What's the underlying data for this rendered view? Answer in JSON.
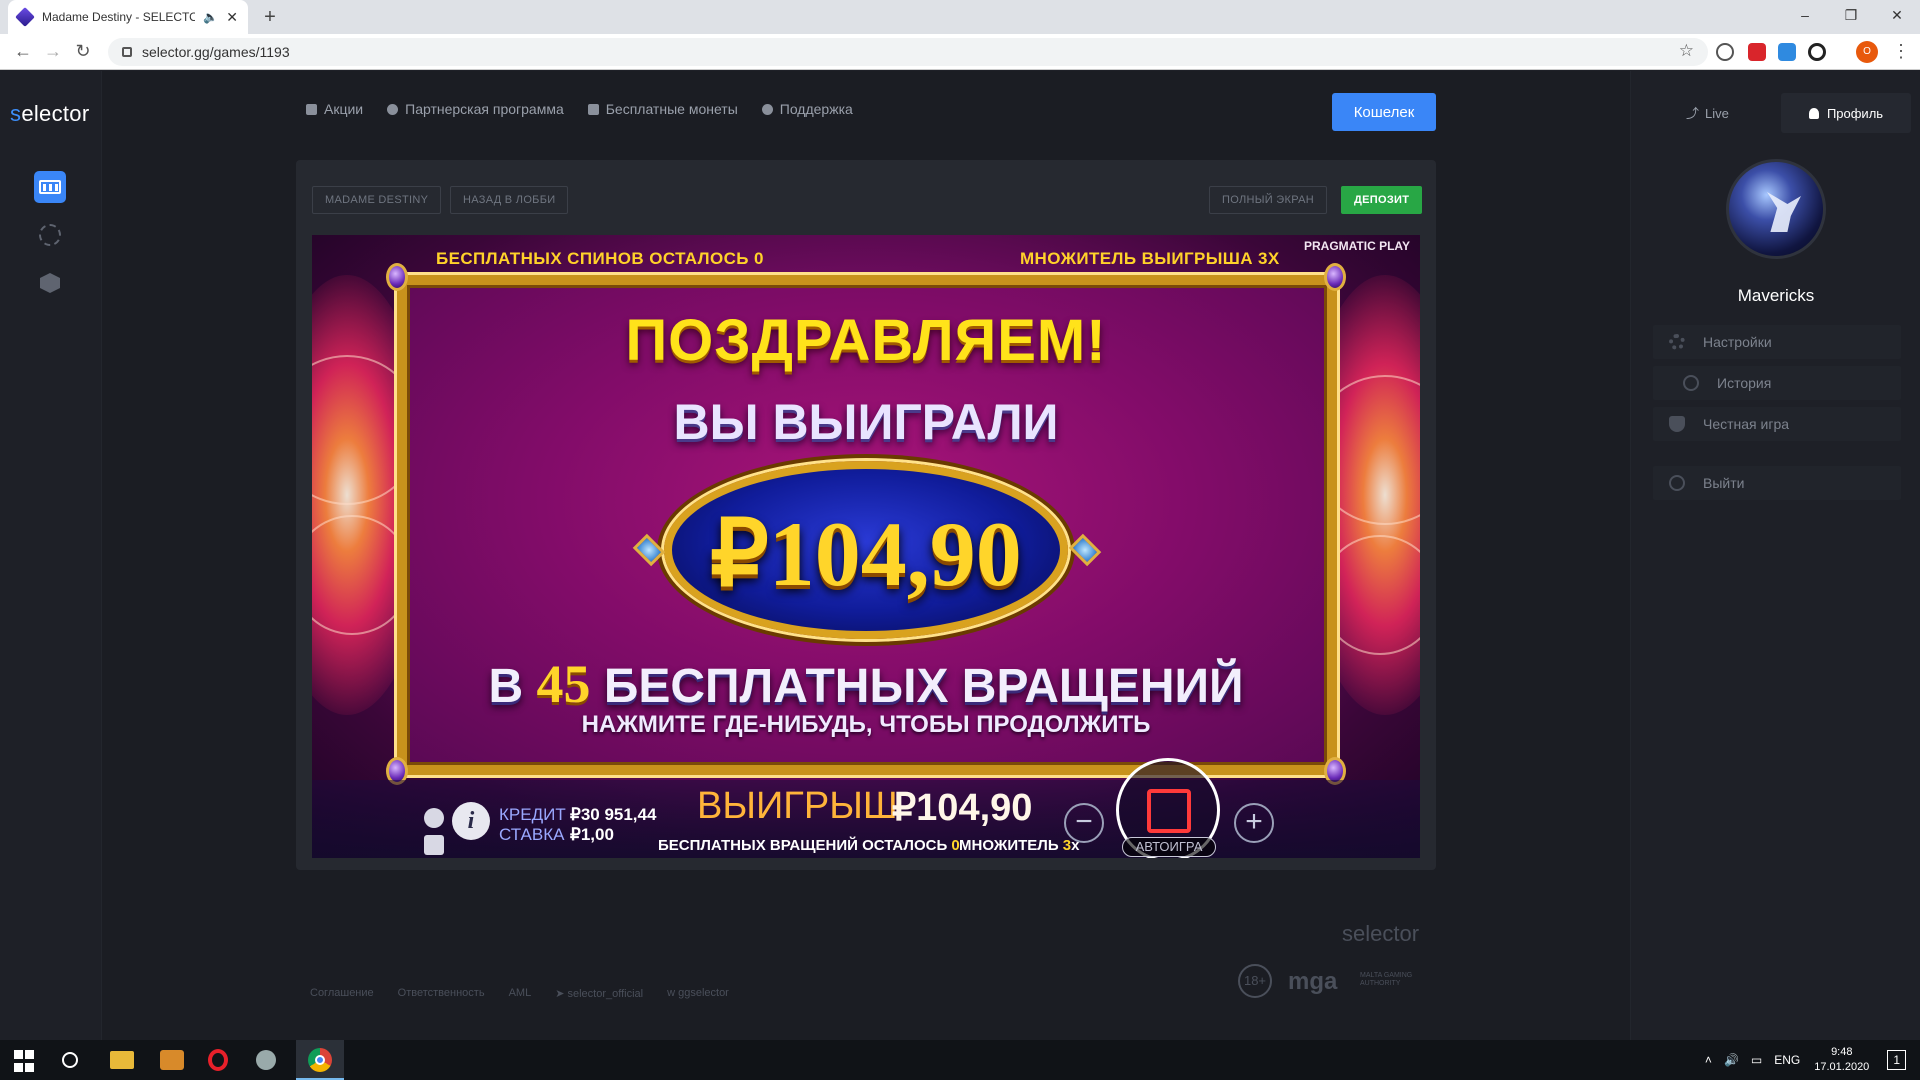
{
  "browser": {
    "tab_title": "Madame Destiny - SELECTOR",
    "tab_speaker_icon": "speaker-icon",
    "new_tab": "+",
    "url": "selector.gg/games/1193",
    "window_controls": [
      "–",
      "❐",
      "✕"
    ]
  },
  "app": {
    "logo_prefix": "s",
    "logo_rest": "elector",
    "nav": [
      {
        "label": "Акции",
        "icon": "calendar-icon"
      },
      {
        "label": "Партнерская программа",
        "icon": "handshake-icon"
      },
      {
        "label": "Бесплатные монеты",
        "icon": "gift-icon"
      },
      {
        "label": "Поддержка",
        "icon": "support-icon"
      }
    ],
    "wallet": "Кошелек",
    "live": "Live",
    "profile": "Профиль"
  },
  "user": {
    "name": "Mavericks",
    "menu": [
      "Настройки",
      "История",
      "Честная игра",
      "Выйти"
    ]
  },
  "game_header": {
    "game_name": "MADAME DESTINY",
    "back": "НАЗАД В ЛОББИ",
    "fullscreen": "ПОЛНЫЙ ЭКРАН",
    "deposit": "ДЕПОЗИТ"
  },
  "game": {
    "free_spins_left": "БЕСПЛАТНЫХ СПИНОВ ОСТАЛОСЬ  0",
    "multiplier": "МНОЖИТЕЛЬ ВЫИГРЫША 3X",
    "provider": "PRAGMATIC PLAY",
    "congrats": "ПОЗДРАВЛЯЕМ!",
    "you_won": "ВЫ ВЫИГРАЛИ",
    "amount": "₽104,90",
    "spins_prefix": "В",
    "spins_num": "45",
    "spins_suffix": "БЕСПЛАТНЫХ ВРАЩЕНИЙ",
    "press_anywhere": "НАЖМИТЕ ГДЕ-НИБУДЬ, ЧТОБЫ ПРОДОЛЖИТЬ",
    "credit_label": "КРЕДИТ",
    "credit_value": "₽30 951,44",
    "bet_label": "СТАВКА",
    "bet_value": "₽1,00",
    "win_label": "ВЫИГРЫШ",
    "win_value": "₽104,90",
    "spins_left_label": "БЕСПЛАТНЫХ ВРАЩЕНИЙ ОСТАЛОСЬ",
    "spins_left_value": "0",
    "mult_label": "МНОЖИТЕЛЬ",
    "mult_value": "3",
    "mult_x": "x",
    "minus": "−",
    "plus": "+",
    "autoplay": "АВТОИГРА",
    "info": "i"
  },
  "footer": {
    "links": [
      "Соглашение",
      "Ответственность",
      "AML",
      "selector_official",
      "ggselector"
    ],
    "brand": "selector",
    "age": "18+",
    "mga": "mga",
    "mga_sub": "MALTA GAMING AUTHORITY"
  },
  "taskbar": {
    "lang": "ENG",
    "time": "9:48",
    "date": "17.01.2020",
    "notifications": "1"
  }
}
